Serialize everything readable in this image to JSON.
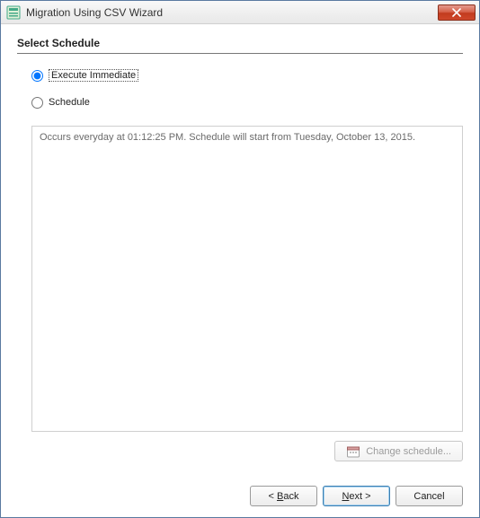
{
  "titlebar": {
    "title": "Migration Using CSV Wizard"
  },
  "section": {
    "heading": "Select Schedule"
  },
  "options": {
    "execute_immediate_label": "Execute Immediate",
    "schedule_label": "Schedule",
    "selected": "execute_immediate"
  },
  "schedule_box": {
    "text": "Occurs everyday at  01:12:25 PM. Schedule will start from Tuesday, October 13, 2015."
  },
  "buttons": {
    "change_schedule": "Change schedule...",
    "back_prefix": "< ",
    "back_mnemonic": "B",
    "back_rest": "ack",
    "next_mnemonic": "N",
    "next_rest": "ext >",
    "cancel": "Cancel"
  }
}
